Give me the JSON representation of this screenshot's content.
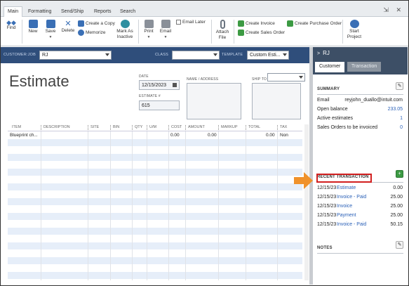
{
  "ribbon": {
    "tabs": [
      "Main",
      "Formatting",
      "Send/Ship",
      "Reports",
      "Search"
    ],
    "active_tab": "Main",
    "window_controls": "⇲ ✕"
  },
  "toolbar": {
    "find": "Find",
    "new": "New",
    "save": "Save",
    "delete": "Delete",
    "create_copy": "Create a Copy",
    "memorize": "Memorize",
    "mark_as_inactive": "Mark As\nInactive",
    "mark_line1": "Mark As",
    "mark_line2": "Inactive",
    "print": "Print",
    "email": "Email",
    "email_later": "Email Later",
    "attach_file_line1": "Attach",
    "attach_file_line2": "File",
    "create_invoice": "Create Invoice",
    "create_sales_order": "Create Sales Order",
    "create_purchase_order": "Create Purchase Order",
    "start_project_line1": "Start",
    "start_project_line2": "Project"
  },
  "header": {
    "customer_job_label": "CUSTOMER:JOB",
    "customer_job_value": "RJ",
    "class_label": "CLASS",
    "class_value": "",
    "template_label": "TEMPLATE",
    "template_value": "Custom Esti..."
  },
  "form": {
    "title": "Estimate",
    "date_label": "DATE",
    "date_value": "12/15/2023",
    "estimate_no_label": "ESTIMATE #",
    "estimate_no_value": "615",
    "name_address_label": "NAME / ADDRESS",
    "ship_to_label": "SHIP TO"
  },
  "table": {
    "columns": [
      "ITEM",
      "DESCRIPTION",
      "SITE",
      "BIN",
      "QTY",
      "U/M",
      "COST",
      "AMOUNT",
      "MARKUP",
      "TOTAL",
      "TAX"
    ],
    "rows": [
      {
        "item": "Blueprint ch...",
        "cost": "0.00",
        "amount": "0.00",
        "total": "0.00",
        "tax": "Non"
      }
    ]
  },
  "panel": {
    "customer_name": "RJ",
    "tab_customer": "Customer",
    "tab_transaction": "Transaction",
    "summary_title": "SUMMARY",
    "summary": [
      {
        "label": "Email",
        "value": "reyjohn_duallo@intuit.com"
      },
      {
        "label": "Open balance",
        "value": "233.05"
      },
      {
        "label": "Active estimates",
        "value": "1"
      },
      {
        "label": "Sales Orders to be invoiced",
        "value": "0"
      }
    ],
    "recent_title": "RECENT TRANSACTION",
    "recent": [
      {
        "date": "12/15/23",
        "type": "Estimate",
        "status": "",
        "amount": "0.00"
      },
      {
        "date": "12/15/23",
        "type": "Invoice",
        "status": "- Paid",
        "amount": "25.00"
      },
      {
        "date": "12/15/23",
        "type": "Invoice",
        "status": "",
        "amount": "25.00"
      },
      {
        "date": "12/15/23",
        "type": "Payment",
        "status": "",
        "amount": "25.00"
      },
      {
        "date": "12/15/23",
        "type": "Invoice",
        "status": "- Paid",
        "amount": "50.15"
      }
    ],
    "notes_title": "NOTES"
  },
  "colors": {
    "header_band": "#2f4e7b",
    "panel_header": "#3d4f66",
    "link": "#2b61b8",
    "highlight_box": "#d21f1f",
    "callout_arrow": "#f0922b",
    "row_alt": "#e6eef9"
  }
}
